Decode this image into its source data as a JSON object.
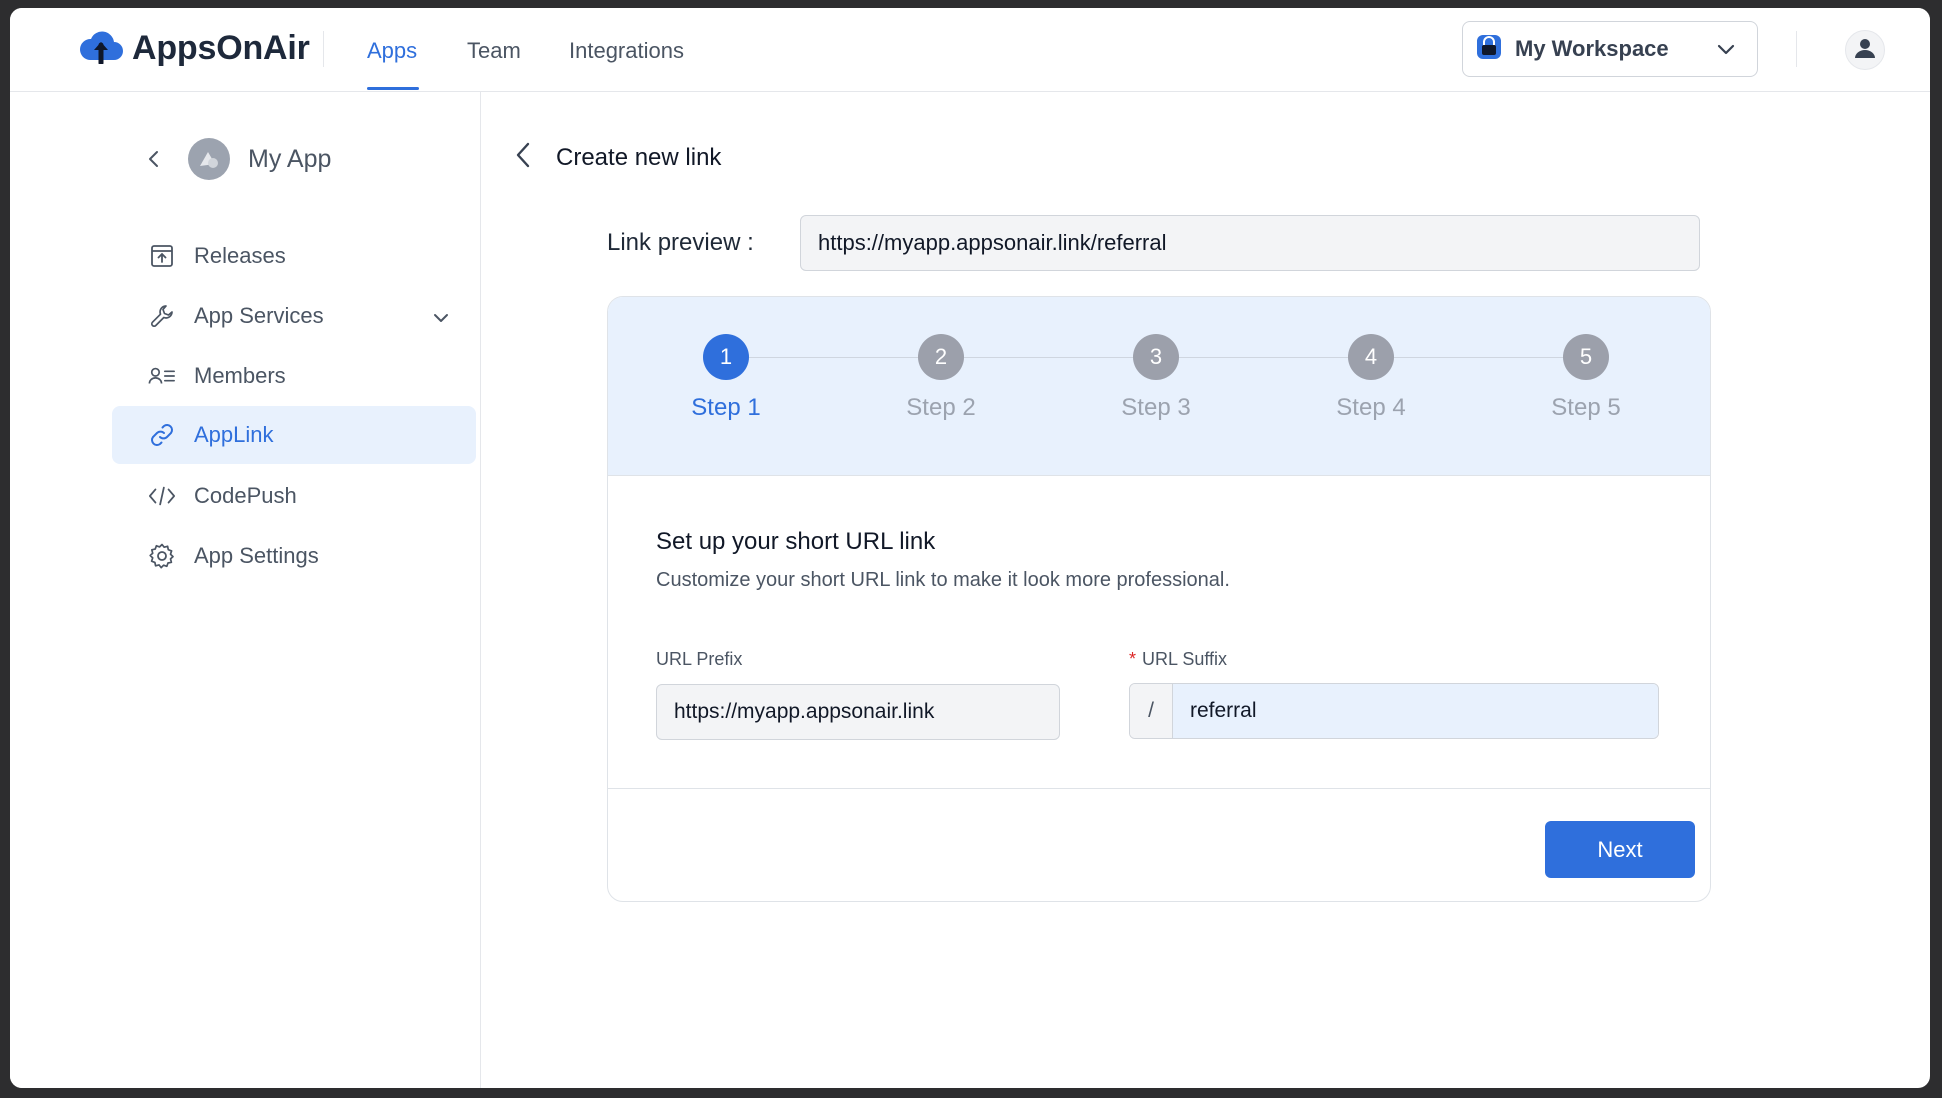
{
  "app": {
    "name": "AppsOnAir",
    "brand_color": "#2f6fdc"
  },
  "nav": {
    "tabs": [
      {
        "label": "Apps",
        "active": true
      },
      {
        "label": "Team",
        "active": false
      },
      {
        "label": "Integrations",
        "active": false
      }
    ]
  },
  "workspace": {
    "label": "My Workspace",
    "icon": "workspace-bag-icon"
  },
  "user": {
    "icon": "user-avatar-icon"
  },
  "sidebar": {
    "app_name": "My App",
    "items": [
      {
        "label": "Releases",
        "icon": "upload-box-icon",
        "active": false
      },
      {
        "label": "App Services",
        "icon": "wrench-icon",
        "active": false,
        "expandable": true
      },
      {
        "label": "Members",
        "icon": "members-icon",
        "active": false
      },
      {
        "label": "AppLink",
        "icon": "link-icon",
        "active": true
      },
      {
        "label": "CodePush",
        "icon": "code-icon",
        "active": false
      },
      {
        "label": "App Settings",
        "icon": "gear-icon",
        "active": false
      }
    ]
  },
  "page": {
    "title": "Create new link",
    "preview_label": "Link preview :",
    "preview_value": "https://myapp.appsonair.link/referral"
  },
  "stepper": {
    "steps": [
      {
        "number": "1",
        "label": "Step 1",
        "active": true
      },
      {
        "number": "2",
        "label": "Step 2",
        "active": false
      },
      {
        "number": "3",
        "label": "Step 3",
        "active": false
      },
      {
        "number": "4",
        "label": "Step 4",
        "active": false
      },
      {
        "number": "5",
        "label": "Step 5",
        "active": false
      }
    ]
  },
  "form": {
    "title": "Set up your short URL link",
    "subtitle": "Customize your short URL link to make it look more professional.",
    "prefix_label": "URL Prefix",
    "prefix_value": "https://myapp.appsonair.link",
    "suffix_required_mark": "*",
    "suffix_label": "URL Suffix",
    "suffix_slash": "/",
    "suffix_value": "referral",
    "next_label": "Next"
  }
}
